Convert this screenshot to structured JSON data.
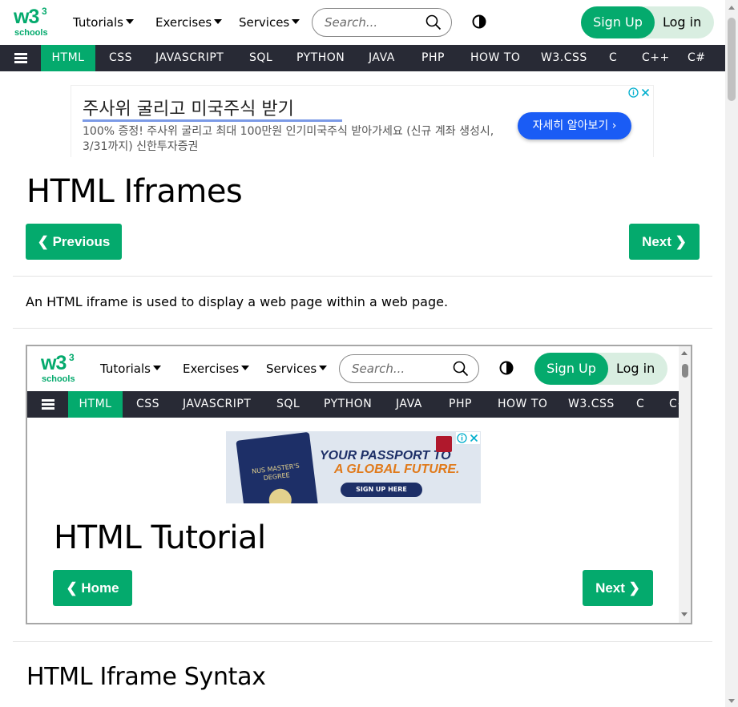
{
  "brand": {
    "logo": "w3",
    "logo_sup": "3",
    "logo_sub": "schools"
  },
  "header": {
    "menus": [
      "Tutorials",
      "Exercises",
      "Services"
    ],
    "search_placeholder": "Search...",
    "signup": "Sign Up",
    "login": "Log in"
  },
  "nav": {
    "items": [
      "HTML",
      "CSS",
      "JAVASCRIPT",
      "SQL",
      "PYTHON",
      "JAVA",
      "PHP",
      "HOW TO",
      "W3.CSS",
      "C",
      "C++",
      "C#"
    ],
    "active": "HTML"
  },
  "ad": {
    "title": "주사위 굴리고 미국주식 받기",
    "description": "100% 증정! 주사위 굴리고 최대 100만원 인기미국주식 받아가세요 (신규 계좌 생성시, 3/31까지) 신한투자증권",
    "cta": "자세히 알아보기 ›"
  },
  "page": {
    "title": "HTML Iframes",
    "prev_button": "❮ Previous",
    "next_button": "Next ❯",
    "intro": "An HTML iframe is used to display a web page within a web page.",
    "section_heading": "HTML Iframe Syntax"
  },
  "iframe": {
    "nav_items": [
      "HTML",
      "CSS",
      "JAVASCRIPT",
      "SQL",
      "PYTHON",
      "JAVA",
      "PHP",
      "HOW TO",
      "W3.CSS",
      "C",
      "C+"
    ],
    "ad": {
      "line1": "YOUR PASSPORT TO",
      "line2": "A GLOBAL FUTURE.",
      "cta": "SIGN UP HERE",
      "passport_text": "NUS MASTER'S DEGREE"
    },
    "title": "HTML Tutorial",
    "home_button": "❮ Home",
    "next_button": "Next ❯"
  },
  "colors": {
    "accent": "#04AA6D",
    "nav_bg": "#282A35",
    "ad_cta": "#1a5cf5"
  }
}
